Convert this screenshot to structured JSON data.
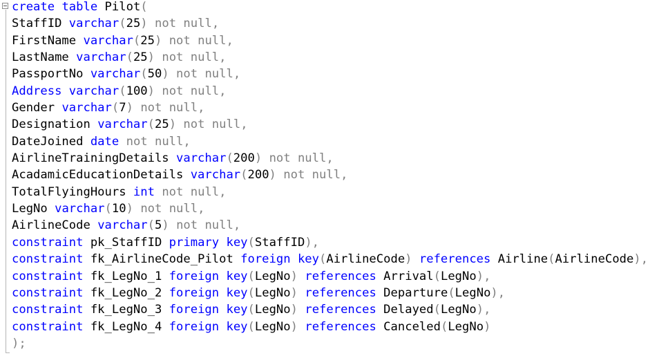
{
  "editor": {
    "colors": {
      "keyword": "#0000ff",
      "identifier": "#000000",
      "operator": "#808080",
      "background": "#ffffff"
    },
    "fold_icon": "collapse-minus-icon",
    "lines": [
      {
        "tokens": [
          {
            "c": "kw",
            "t": "create"
          },
          {
            "c": "id",
            "t": " "
          },
          {
            "c": "kw",
            "t": "table"
          },
          {
            "c": "id",
            "t": " Pilot"
          },
          {
            "c": "gr",
            "t": "("
          }
        ]
      },
      {
        "tokens": [
          {
            "c": "id",
            "t": "StaffID "
          },
          {
            "c": "kw",
            "t": "varchar"
          },
          {
            "c": "gr",
            "t": "("
          },
          {
            "c": "id",
            "t": "25"
          },
          {
            "c": "gr",
            "t": ")"
          },
          {
            "c": "id",
            "t": " "
          },
          {
            "c": "gr",
            "t": "not null"
          },
          {
            "c": "gr",
            "t": ","
          }
        ]
      },
      {
        "tokens": [
          {
            "c": "id",
            "t": "FirstName "
          },
          {
            "c": "kw",
            "t": "varchar"
          },
          {
            "c": "gr",
            "t": "("
          },
          {
            "c": "id",
            "t": "25"
          },
          {
            "c": "gr",
            "t": ")"
          },
          {
            "c": "id",
            "t": " "
          },
          {
            "c": "gr",
            "t": "not null"
          },
          {
            "c": "gr",
            "t": ","
          }
        ]
      },
      {
        "tokens": [
          {
            "c": "id",
            "t": "LastName "
          },
          {
            "c": "kw",
            "t": "varchar"
          },
          {
            "c": "gr",
            "t": "("
          },
          {
            "c": "id",
            "t": "25"
          },
          {
            "c": "gr",
            "t": ")"
          },
          {
            "c": "id",
            "t": " "
          },
          {
            "c": "gr",
            "t": "not null"
          },
          {
            "c": "gr",
            "t": ","
          }
        ]
      },
      {
        "tokens": [
          {
            "c": "id",
            "t": "PassportNo "
          },
          {
            "c": "kw",
            "t": "varchar"
          },
          {
            "c": "gr",
            "t": "("
          },
          {
            "c": "id",
            "t": "50"
          },
          {
            "c": "gr",
            "t": ")"
          },
          {
            "c": "id",
            "t": " "
          },
          {
            "c": "gr",
            "t": "not null"
          },
          {
            "c": "gr",
            "t": ","
          }
        ]
      },
      {
        "tokens": [
          {
            "c": "kw",
            "t": "Address"
          },
          {
            "c": "id",
            "t": " "
          },
          {
            "c": "kw",
            "t": "varchar"
          },
          {
            "c": "gr",
            "t": "("
          },
          {
            "c": "id",
            "t": "100"
          },
          {
            "c": "gr",
            "t": ")"
          },
          {
            "c": "id",
            "t": " "
          },
          {
            "c": "gr",
            "t": "not null"
          },
          {
            "c": "gr",
            "t": ","
          }
        ]
      },
      {
        "tokens": [
          {
            "c": "id",
            "t": "Gender "
          },
          {
            "c": "kw",
            "t": "varchar"
          },
          {
            "c": "gr",
            "t": "("
          },
          {
            "c": "id",
            "t": "7"
          },
          {
            "c": "gr",
            "t": ")"
          },
          {
            "c": "id",
            "t": " "
          },
          {
            "c": "gr",
            "t": "not null"
          },
          {
            "c": "gr",
            "t": ","
          }
        ]
      },
      {
        "tokens": [
          {
            "c": "id",
            "t": "Designation "
          },
          {
            "c": "kw",
            "t": "varchar"
          },
          {
            "c": "gr",
            "t": "("
          },
          {
            "c": "id",
            "t": "25"
          },
          {
            "c": "gr",
            "t": ")"
          },
          {
            "c": "id",
            "t": " "
          },
          {
            "c": "gr",
            "t": "not null"
          },
          {
            "c": "gr",
            "t": ","
          }
        ]
      },
      {
        "tokens": [
          {
            "c": "id",
            "t": "DateJoined "
          },
          {
            "c": "kw",
            "t": "date"
          },
          {
            "c": "id",
            "t": " "
          },
          {
            "c": "gr",
            "t": "not null"
          },
          {
            "c": "gr",
            "t": ","
          }
        ]
      },
      {
        "tokens": [
          {
            "c": "id",
            "t": "AirlineTrainingDetails "
          },
          {
            "c": "kw",
            "t": "varchar"
          },
          {
            "c": "gr",
            "t": "("
          },
          {
            "c": "id",
            "t": "200"
          },
          {
            "c": "gr",
            "t": ")"
          },
          {
            "c": "id",
            "t": " "
          },
          {
            "c": "gr",
            "t": "not null"
          },
          {
            "c": "gr",
            "t": ","
          }
        ]
      },
      {
        "tokens": [
          {
            "c": "id",
            "t": "AcadamicEducationDetails "
          },
          {
            "c": "kw",
            "t": "varchar"
          },
          {
            "c": "gr",
            "t": "("
          },
          {
            "c": "id",
            "t": "200"
          },
          {
            "c": "gr",
            "t": ")"
          },
          {
            "c": "id",
            "t": " "
          },
          {
            "c": "gr",
            "t": "not null"
          },
          {
            "c": "gr",
            "t": ","
          }
        ]
      },
      {
        "tokens": [
          {
            "c": "id",
            "t": "TotalFlyingHours "
          },
          {
            "c": "kw",
            "t": "int"
          },
          {
            "c": "id",
            "t": " "
          },
          {
            "c": "gr",
            "t": "not null"
          },
          {
            "c": "gr",
            "t": ","
          }
        ]
      },
      {
        "tokens": [
          {
            "c": "id",
            "t": "LegNo "
          },
          {
            "c": "kw",
            "t": "varchar"
          },
          {
            "c": "gr",
            "t": "("
          },
          {
            "c": "id",
            "t": "10"
          },
          {
            "c": "gr",
            "t": ")"
          },
          {
            "c": "id",
            "t": " "
          },
          {
            "c": "gr",
            "t": "not null"
          },
          {
            "c": "gr",
            "t": ","
          }
        ]
      },
      {
        "tokens": [
          {
            "c": "id",
            "t": "AirlineCode "
          },
          {
            "c": "kw",
            "t": "varchar"
          },
          {
            "c": "gr",
            "t": "("
          },
          {
            "c": "id",
            "t": "5"
          },
          {
            "c": "gr",
            "t": ")"
          },
          {
            "c": "id",
            "t": " "
          },
          {
            "c": "gr",
            "t": "not null"
          },
          {
            "c": "gr",
            "t": ","
          }
        ]
      },
      {
        "tokens": [
          {
            "c": "kw",
            "t": "constraint"
          },
          {
            "c": "id",
            "t": " pk_StaffID "
          },
          {
            "c": "kw",
            "t": "primary"
          },
          {
            "c": "id",
            "t": " "
          },
          {
            "c": "kw",
            "t": "key"
          },
          {
            "c": "gr",
            "t": "("
          },
          {
            "c": "id",
            "t": "StaffID"
          },
          {
            "c": "gr",
            "t": ")"
          },
          {
            "c": "gr",
            "t": ","
          }
        ]
      },
      {
        "tokens": [
          {
            "c": "kw",
            "t": "constraint"
          },
          {
            "c": "id",
            "t": " fk_AirlineCode_Pilot "
          },
          {
            "c": "kw",
            "t": "foreign"
          },
          {
            "c": "id",
            "t": " "
          },
          {
            "c": "kw",
            "t": "key"
          },
          {
            "c": "gr",
            "t": "("
          },
          {
            "c": "id",
            "t": "AirlineCode"
          },
          {
            "c": "gr",
            "t": ")"
          },
          {
            "c": "id",
            "t": " "
          },
          {
            "c": "kw",
            "t": "references"
          },
          {
            "c": "id",
            "t": " Airline"
          },
          {
            "c": "gr",
            "t": "("
          },
          {
            "c": "id",
            "t": "AirlineCode"
          },
          {
            "c": "gr",
            "t": ")"
          },
          {
            "c": "gr",
            "t": ","
          }
        ]
      },
      {
        "tokens": [
          {
            "c": "kw",
            "t": "constraint"
          },
          {
            "c": "id",
            "t": " fk_LegNo_1 "
          },
          {
            "c": "kw",
            "t": "foreign"
          },
          {
            "c": "id",
            "t": " "
          },
          {
            "c": "kw",
            "t": "key"
          },
          {
            "c": "gr",
            "t": "("
          },
          {
            "c": "id",
            "t": "LegNo"
          },
          {
            "c": "gr",
            "t": ")"
          },
          {
            "c": "id",
            "t": " "
          },
          {
            "c": "kw",
            "t": "references"
          },
          {
            "c": "id",
            "t": " Arrival"
          },
          {
            "c": "gr",
            "t": "("
          },
          {
            "c": "id",
            "t": "LegNo"
          },
          {
            "c": "gr",
            "t": ")"
          },
          {
            "c": "gr",
            "t": ","
          }
        ]
      },
      {
        "tokens": [
          {
            "c": "kw",
            "t": "constraint"
          },
          {
            "c": "id",
            "t": " fk_LegNo_2 "
          },
          {
            "c": "kw",
            "t": "foreign"
          },
          {
            "c": "id",
            "t": " "
          },
          {
            "c": "kw",
            "t": "key"
          },
          {
            "c": "gr",
            "t": "("
          },
          {
            "c": "id",
            "t": "LegNo"
          },
          {
            "c": "gr",
            "t": ")"
          },
          {
            "c": "id",
            "t": " "
          },
          {
            "c": "kw",
            "t": "references"
          },
          {
            "c": "id",
            "t": " Departure"
          },
          {
            "c": "gr",
            "t": "("
          },
          {
            "c": "id",
            "t": "LegNo"
          },
          {
            "c": "gr",
            "t": ")"
          },
          {
            "c": "gr",
            "t": ","
          }
        ]
      },
      {
        "tokens": [
          {
            "c": "kw",
            "t": "constraint"
          },
          {
            "c": "id",
            "t": " fk_LegNo_3 "
          },
          {
            "c": "kw",
            "t": "foreign"
          },
          {
            "c": "id",
            "t": " "
          },
          {
            "c": "kw",
            "t": "key"
          },
          {
            "c": "gr",
            "t": "("
          },
          {
            "c": "id",
            "t": "LegNo"
          },
          {
            "c": "gr",
            "t": ")"
          },
          {
            "c": "id",
            "t": " "
          },
          {
            "c": "kw",
            "t": "references"
          },
          {
            "c": "id",
            "t": " Delayed"
          },
          {
            "c": "gr",
            "t": "("
          },
          {
            "c": "id",
            "t": "LegNo"
          },
          {
            "c": "gr",
            "t": ")"
          },
          {
            "c": "gr",
            "t": ","
          }
        ]
      },
      {
        "tokens": [
          {
            "c": "kw",
            "t": "constraint"
          },
          {
            "c": "id",
            "t": " fk_LegNo_4 "
          },
          {
            "c": "kw",
            "t": "foreign"
          },
          {
            "c": "id",
            "t": " "
          },
          {
            "c": "kw",
            "t": "key"
          },
          {
            "c": "gr",
            "t": "("
          },
          {
            "c": "id",
            "t": "LegNo"
          },
          {
            "c": "gr",
            "t": ")"
          },
          {
            "c": "id",
            "t": " "
          },
          {
            "c": "kw",
            "t": "references"
          },
          {
            "c": "id",
            "t": " Canceled"
          },
          {
            "c": "gr",
            "t": "("
          },
          {
            "c": "id",
            "t": "LegNo"
          },
          {
            "c": "gr",
            "t": ")"
          }
        ]
      },
      {
        "tokens": [
          {
            "c": "gr",
            "t": ");"
          }
        ]
      }
    ]
  }
}
